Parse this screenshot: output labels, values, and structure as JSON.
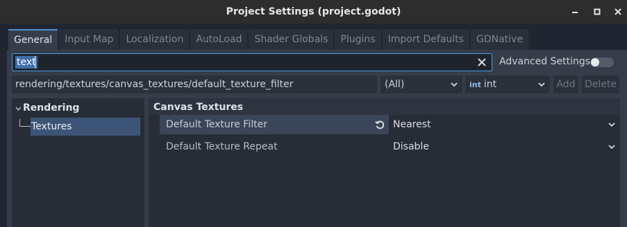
{
  "window": {
    "title": "Project Settings (project.godot)"
  },
  "tabs": [
    {
      "label": "General",
      "active": true
    },
    {
      "label": "Input Map"
    },
    {
      "label": "Localization"
    },
    {
      "label": "AutoLoad"
    },
    {
      "label": "Shader Globals"
    },
    {
      "label": "Plugins"
    },
    {
      "label": "Import Defaults"
    },
    {
      "label": "GDNative"
    }
  ],
  "search": {
    "value": "text"
  },
  "advanced": {
    "label": "Advanced Settings",
    "enabled": false
  },
  "path_field": {
    "value": "rendering/textures/canvas_textures/default_texture_filter"
  },
  "scope_dropdown": {
    "value": "(All)"
  },
  "type_dropdown": {
    "icon_text": "int",
    "value": "int"
  },
  "buttons": {
    "add": "Add",
    "delete": "Delete"
  },
  "tree": {
    "category": "Rendering",
    "item": "Textures"
  },
  "inspector": {
    "section": "Canvas Textures",
    "rows": [
      {
        "name": "Default Texture Filter",
        "value": "Nearest",
        "selected": true
      },
      {
        "name": "Default Texture Repeat",
        "value": "Disable",
        "selected": false
      }
    ]
  },
  "colors": {
    "accent": "#4b9fe0",
    "selection": "#3c5576"
  }
}
